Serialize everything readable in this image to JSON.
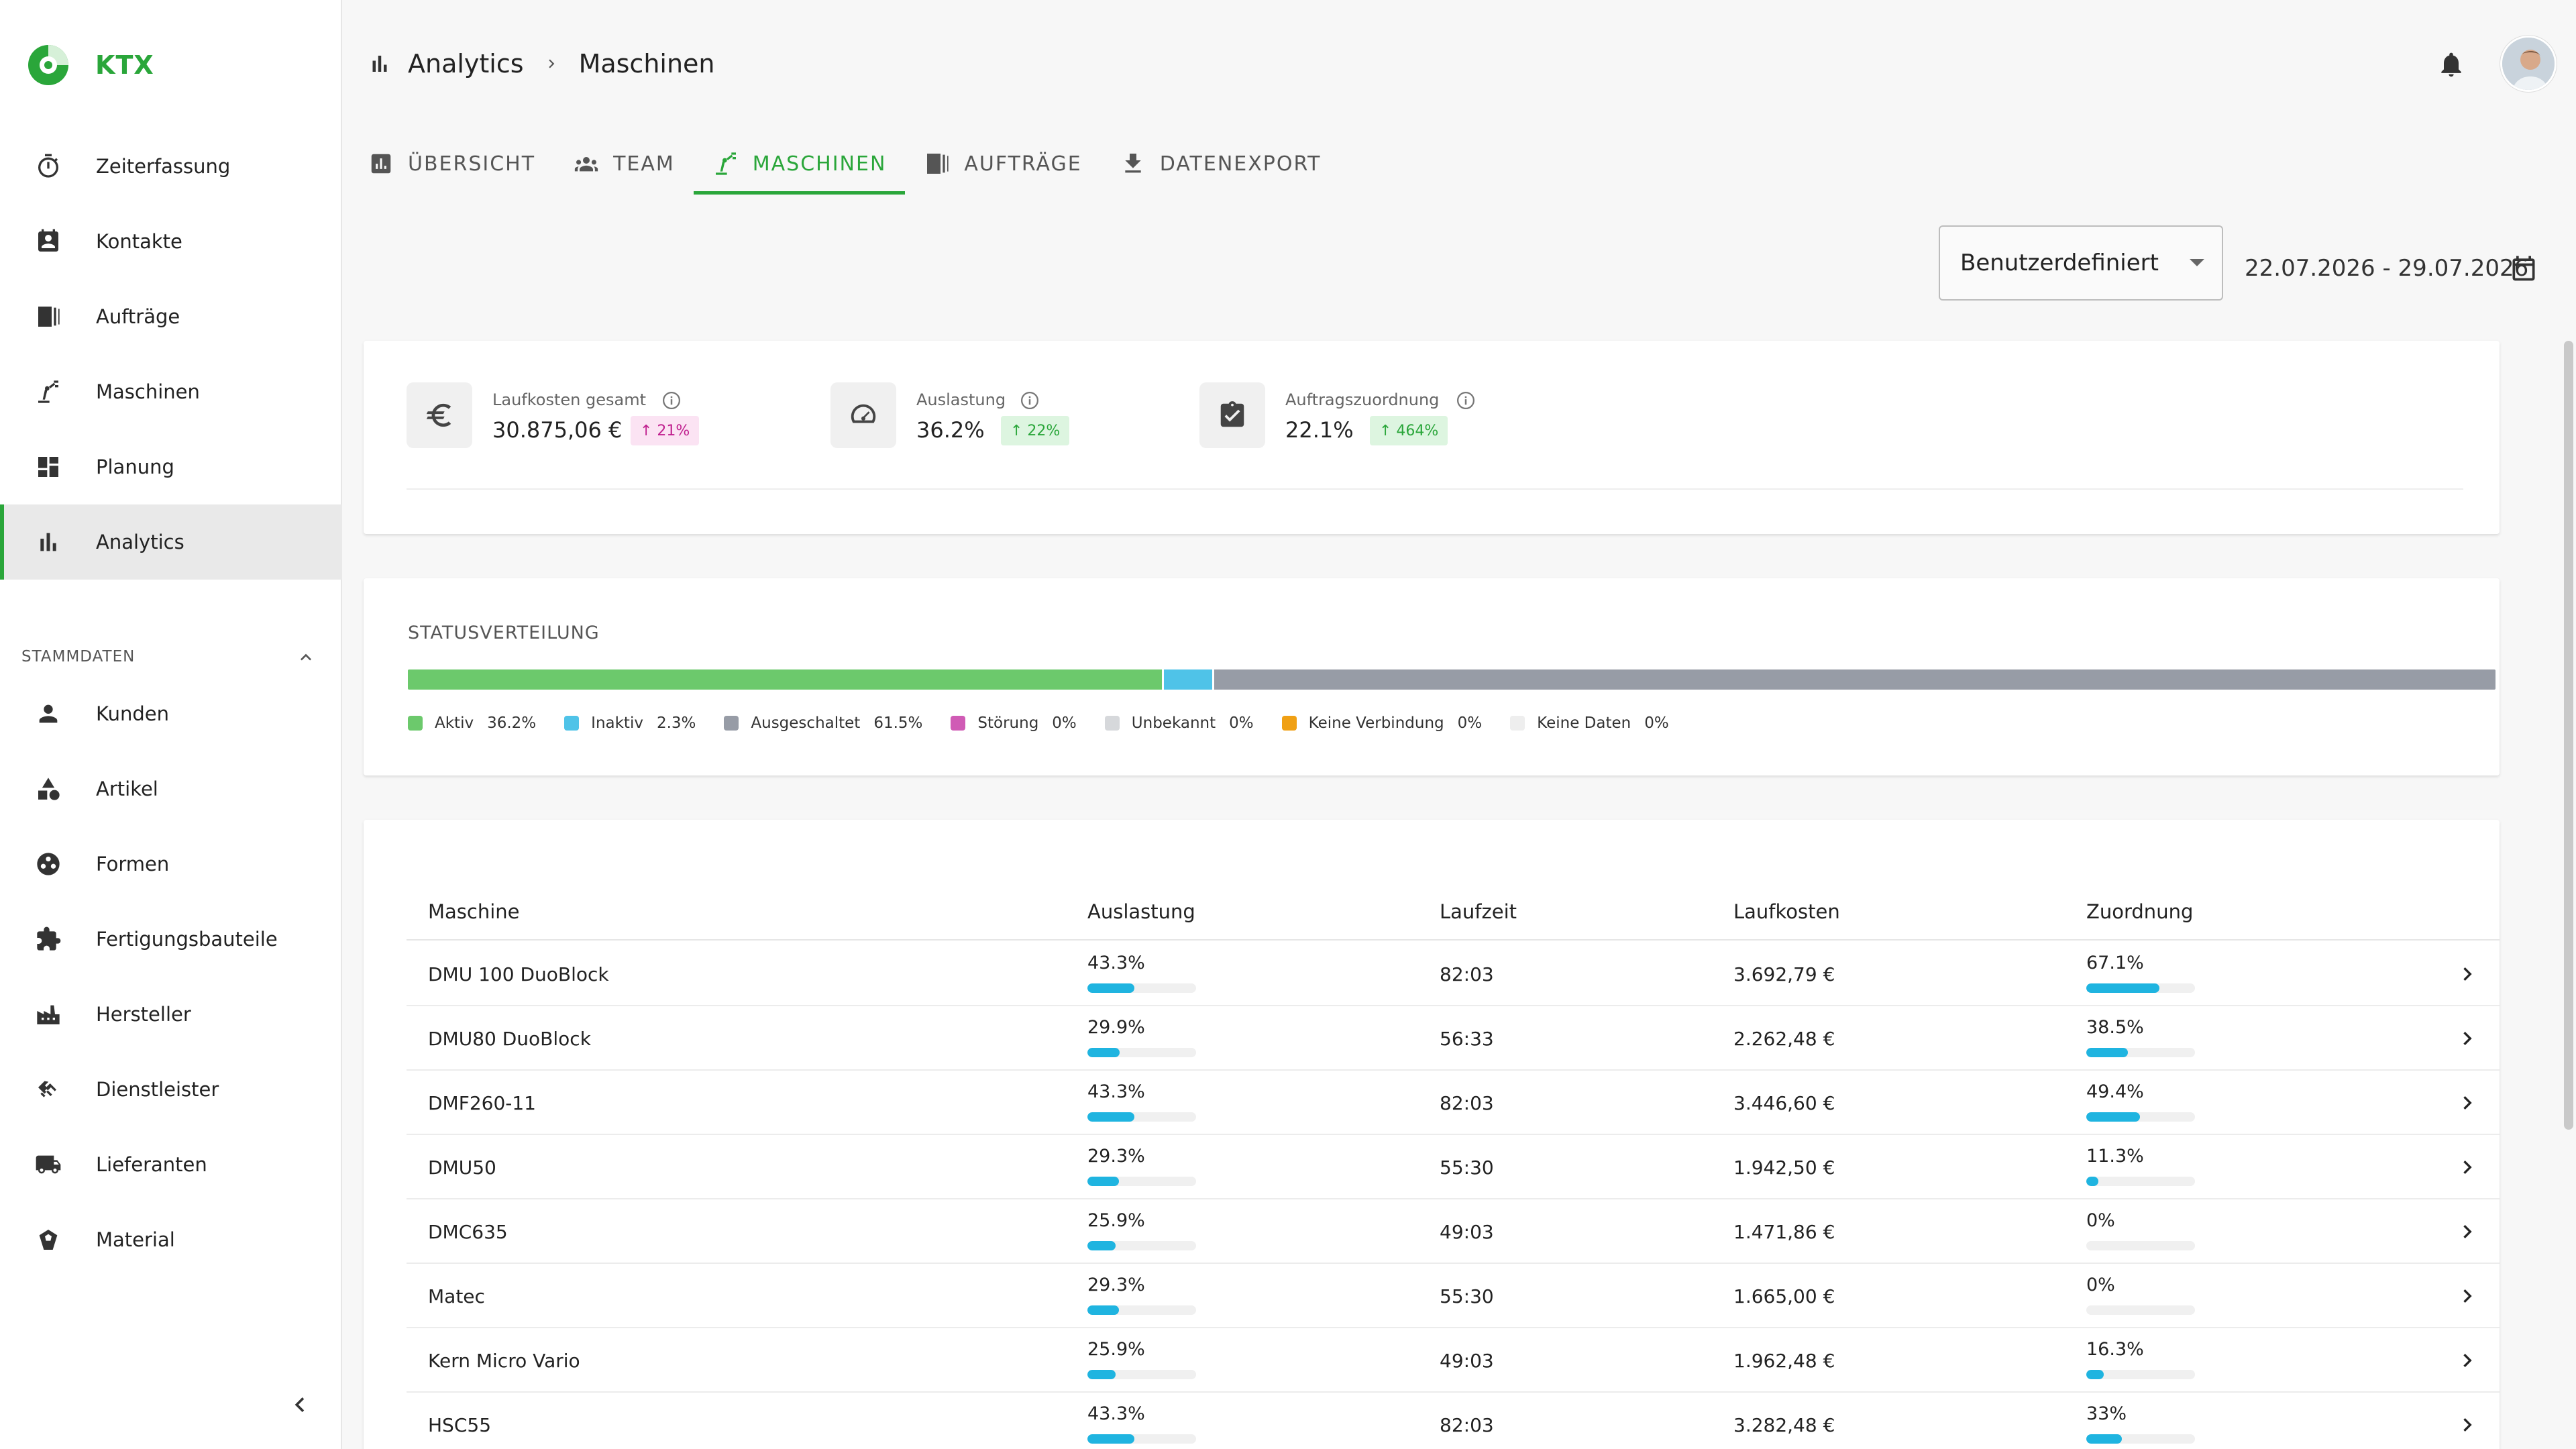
{
  "brand": {
    "name": "KTX",
    "color": "#2aa63a"
  },
  "sidebar": {
    "items": [
      {
        "label": "Zeiterfassung",
        "icon": "stopwatch-icon"
      },
      {
        "label": "Kontakte",
        "icon": "contact-card-icon"
      },
      {
        "label": "Aufträge",
        "icon": "orders-icon"
      },
      {
        "label": "Maschinen",
        "icon": "robot-arm-icon"
      },
      {
        "label": "Planung",
        "icon": "dashboard-icon"
      },
      {
        "label": "Analytics",
        "icon": "bar-chart-icon",
        "active": true
      }
    ],
    "section_title": "STAMMDATEN",
    "master_items": [
      {
        "label": "Kunden",
        "icon": "person-icon"
      },
      {
        "label": "Artikel",
        "icon": "shapes-icon"
      },
      {
        "label": "Formen",
        "icon": "mold-icon"
      },
      {
        "label": "Fertigungsbauteile",
        "icon": "puzzle-icon"
      },
      {
        "label": "Hersteller",
        "icon": "factory-icon"
      },
      {
        "label": "Dienstleister",
        "icon": "handshake-icon"
      },
      {
        "label": "Lieferanten",
        "icon": "truck-icon"
      },
      {
        "label": "Material",
        "icon": "material-icon"
      }
    ]
  },
  "breadcrumb": {
    "section": "Analytics",
    "page": "Maschinen"
  },
  "tabs": [
    {
      "label": "ÜBERSICHT",
      "icon": "summary-icon"
    },
    {
      "label": "TEAM",
      "icon": "team-icon"
    },
    {
      "label": "MASCHINEN",
      "icon": "robot-arm-icon",
      "active": true
    },
    {
      "label": "AUFTRÄGE",
      "icon": "orders-icon"
    },
    {
      "label": "DATENEXPORT",
      "icon": "download-icon"
    }
  ],
  "filters": {
    "period": "Benutzerdefiniert",
    "date_range": "22.07.2026 - 29.07.2026"
  },
  "kpis": [
    {
      "label": "Laufkosten gesamt",
      "value": "30.875,06 €",
      "change": "↑ 21%",
      "icon": "euro-icon"
    },
    {
      "label": "Auslastung",
      "value": "36.2%",
      "change": "↑ 22%",
      "icon": "speedometer-icon"
    },
    {
      "label": "Auftragszuordnung",
      "value": "22.1%",
      "change": "↑ 464%",
      "icon": "clipboard-check-icon"
    }
  ],
  "status": {
    "title": "STATUSVERTEILUNG",
    "segments": [
      {
        "name": "Aktiv",
        "label": "36.2%",
        "value": 36.2,
        "color": "#6cc96c"
      },
      {
        "name": "Inaktiv",
        "label": "2.3%",
        "value": 2.3,
        "color": "#4fc3e8"
      },
      {
        "name": "Ausgeschaltet",
        "label": "61.5%",
        "value": 61.5,
        "color": "#979ca6"
      },
      {
        "name": "Störung",
        "label": "0%",
        "value": 0,
        "color": "#d05bb5"
      },
      {
        "name": "Unbekannt",
        "label": "0%",
        "value": 0,
        "color": "#d6d8db"
      },
      {
        "name": "Keine Verbindung",
        "label": "0%",
        "value": 0,
        "color": "#f0a014"
      },
      {
        "name": "Keine Daten",
        "label": "0%",
        "value": 0,
        "color": "#eeeeee"
      }
    ]
  },
  "table": {
    "headers": {
      "machine": "Maschine",
      "utilization": "Auslastung",
      "runtime": "Laufzeit",
      "cost": "Laufkosten",
      "assignment": "Zuordnung"
    },
    "rows": [
      {
        "name": "DMU 100 DuoBlock",
        "util": "43.3%",
        "util_v": 43.3,
        "time": "82:03",
        "cost": "3.692,79 €",
        "assign": "67.1%",
        "assign_v": 67.1
      },
      {
        "name": "DMU80 DuoBlock",
        "util": "29.9%",
        "util_v": 29.9,
        "time": "56:33",
        "cost": "2.262,48 €",
        "assign": "38.5%",
        "assign_v": 38.5
      },
      {
        "name": "DMF260-11",
        "util": "43.3%",
        "util_v": 43.3,
        "time": "82:03",
        "cost": "3.446,60 €",
        "assign": "49.4%",
        "assign_v": 49.4
      },
      {
        "name": "DMU50",
        "util": "29.3%",
        "util_v": 29.3,
        "time": "55:30",
        "cost": "1.942,50 €",
        "assign": "11.3%",
        "assign_v": 11.3
      },
      {
        "name": "DMC635",
        "util": "25.9%",
        "util_v": 25.9,
        "time": "49:03",
        "cost": "1.471,86 €",
        "assign": "0%",
        "assign_v": 0
      },
      {
        "name": "Matec",
        "util": "29.3%",
        "util_v": 29.3,
        "time": "55:30",
        "cost": "1.665,00 €",
        "assign": "0%",
        "assign_v": 0
      },
      {
        "name": "Kern Micro Vario",
        "util": "25.9%",
        "util_v": 25.9,
        "time": "49:03",
        "cost": "1.962,48 €",
        "assign": "16.3%",
        "assign_v": 16.3
      },
      {
        "name": "HSC55",
        "util": "43.3%",
        "util_v": 43.3,
        "time": "82:03",
        "cost": "3.282,48 €",
        "assign": "33%",
        "assign_v": 33
      }
    ]
  }
}
